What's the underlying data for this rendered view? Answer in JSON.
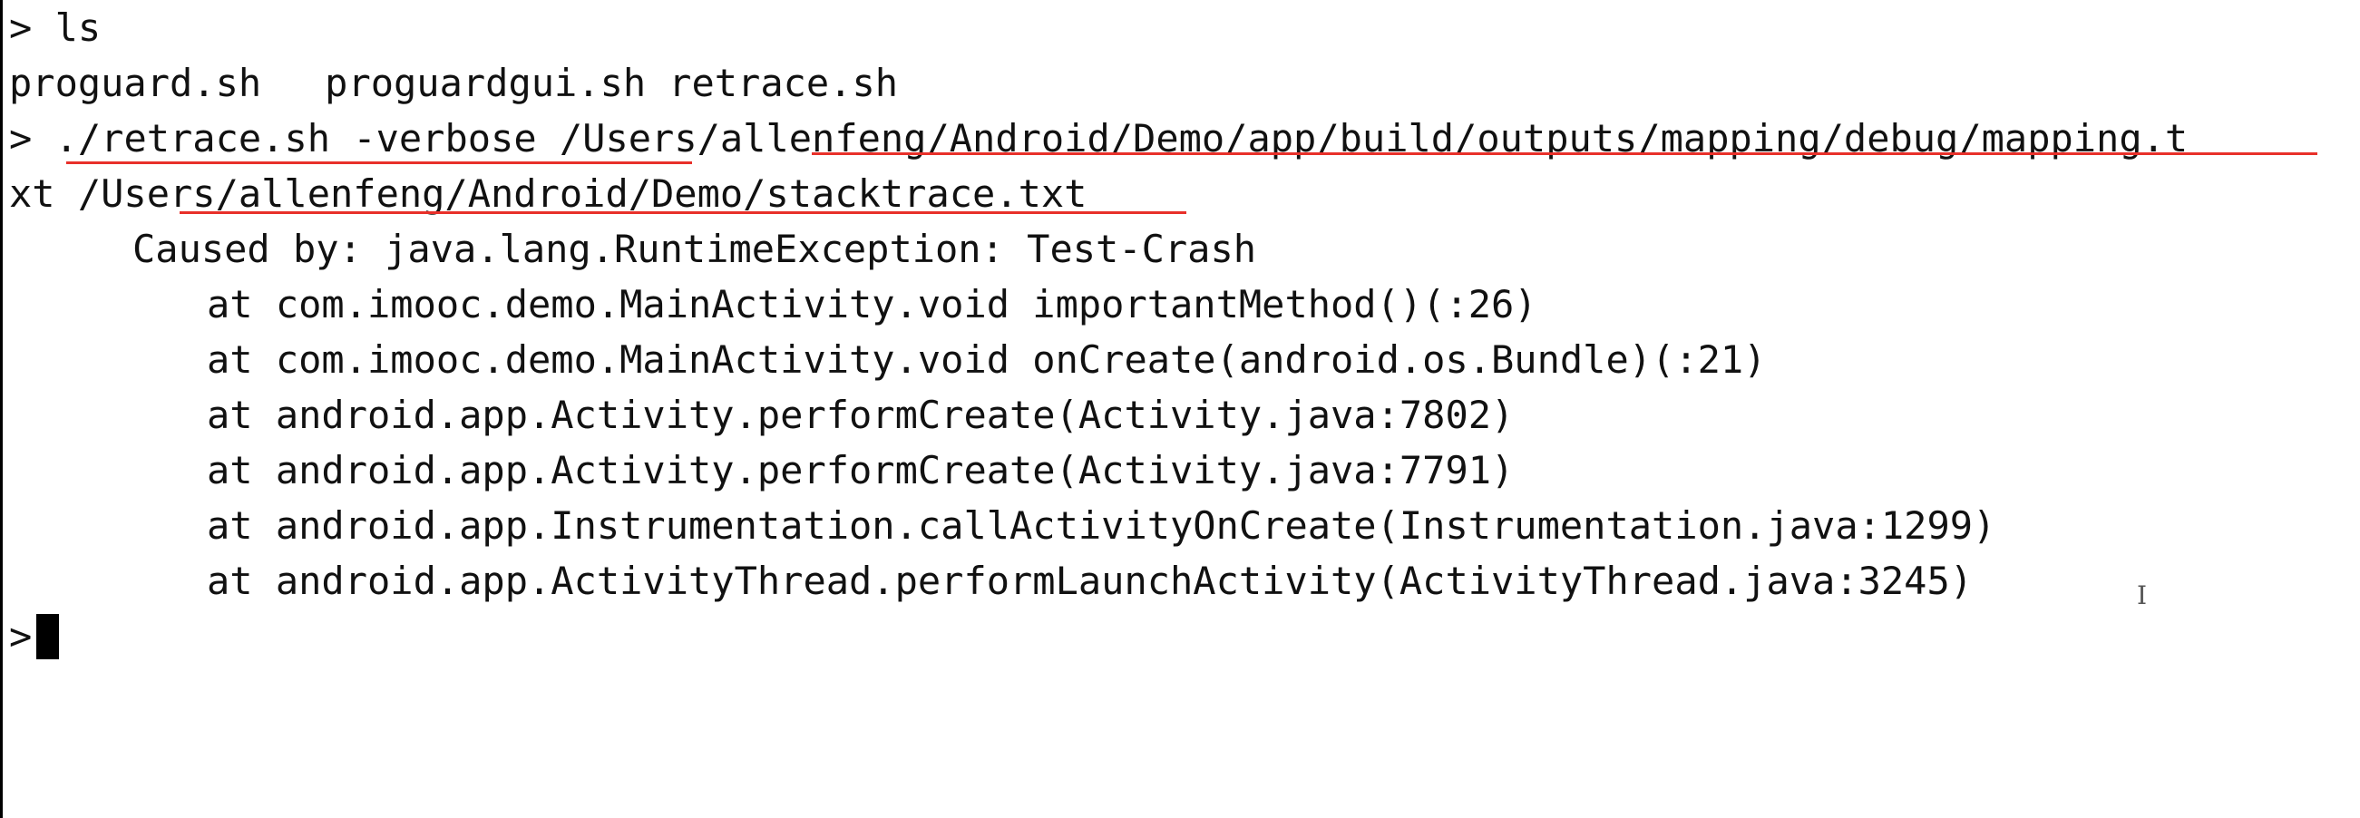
{
  "terminal": {
    "prompt": ">",
    "cmd1": "ls",
    "files": [
      "proguard.sh",
      "proguardgui.sh",
      "retrace.sh"
    ],
    "cmd2_part1": "./retrace.sh -verbose /Users/allenfeng/Android/Demo/app/build/outputs/mapping/debug/mapping.t",
    "cmd2_part2": "xt /Users/allenfeng/Android/Demo/stacktrace.txt",
    "caused_by": "Caused by: java.lang.RuntimeException: Test-Crash",
    "stack": [
      "at com.imooc.demo.MainActivity.void importantMethod()(:26)",
      "at com.imooc.demo.MainActivity.void onCreate(android.os.Bundle)(:21)",
      "at android.app.Activity.performCreate(Activity.java:7802)",
      "at android.app.Activity.performCreate(Activity.java:7791)",
      "at android.app.Instrumentation.callActivityOnCreate(Instrumentation.java:1299)",
      "at android.app.ActivityThread.performLaunchActivity(ActivityThread.java:3245)"
    ]
  },
  "colors": {
    "background": "#ffffff",
    "text": "#111111",
    "annotation_underline": "#e8302a",
    "cursor": "#000000"
  }
}
